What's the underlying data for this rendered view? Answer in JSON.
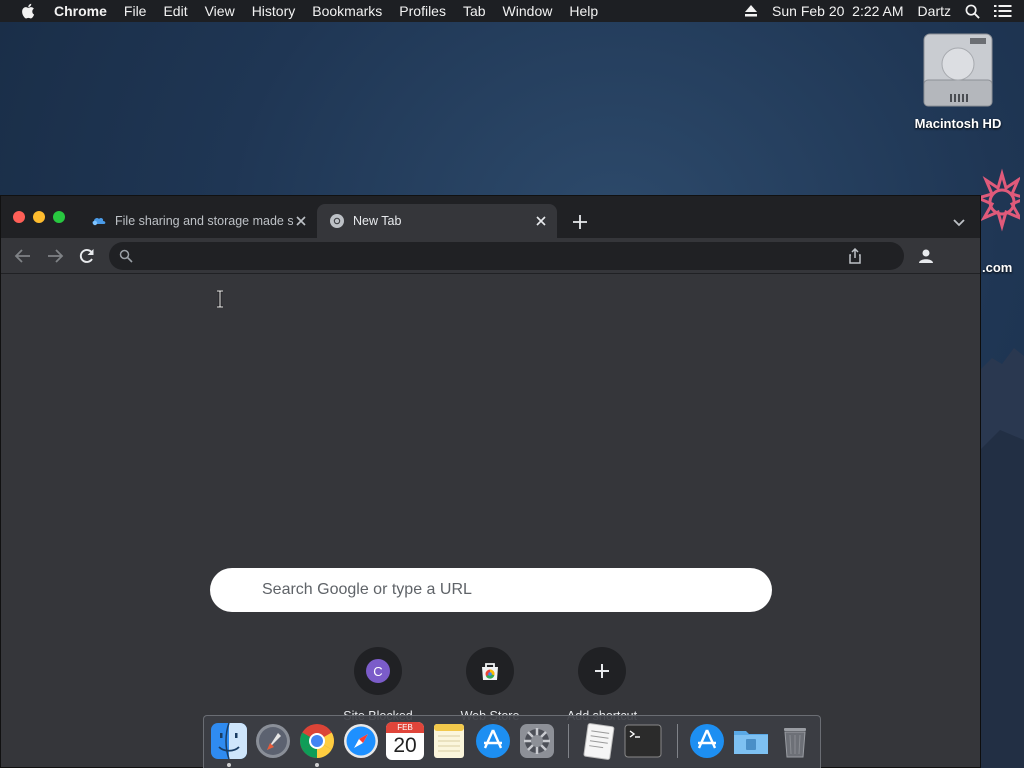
{
  "menubar": {
    "app_name": "Chrome",
    "items": [
      "File",
      "Edit",
      "View",
      "History",
      "Bookmarks",
      "Profiles",
      "Tab",
      "Window",
      "Help"
    ],
    "datetime": "Sun Feb 20  2:22 AM",
    "user": "Dartz"
  },
  "desktop": {
    "hd_label": "Macintosh HD",
    "partial_label": ".com"
  },
  "browser": {
    "tabs": [
      {
        "title": "File sharing and storage made simple"
      },
      {
        "title": "New Tab"
      }
    ],
    "omnibox_value": "",
    "ntp": {
      "search_placeholder": "Search Google or type a URL",
      "shortcuts": [
        {
          "label": "Site Blocked",
          "letter": "C"
        },
        {
          "label": "Web Store"
        },
        {
          "label": "Add shortcut"
        }
      ]
    }
  },
  "dock": {
    "calendar_month": "FEB",
    "calendar_day": "20",
    "items": [
      "finder-icon",
      "launchpad-icon",
      "chrome-icon",
      "safari-icon",
      "calendar-icon",
      "notes-icon",
      "app-store-icon",
      "system-preferences-icon",
      "textedit-icon",
      "terminal-icon",
      "app-store-downloads-icon",
      "documents-folder-icon",
      "trash-icon"
    ]
  },
  "colors": {
    "tabstrip": "#202124",
    "toolbar": "#35363a",
    "shortcut_avatar": "#7b5cc9",
    "close": "#ff5f57",
    "minimize": "#febc2e",
    "maximize": "#28c840"
  }
}
